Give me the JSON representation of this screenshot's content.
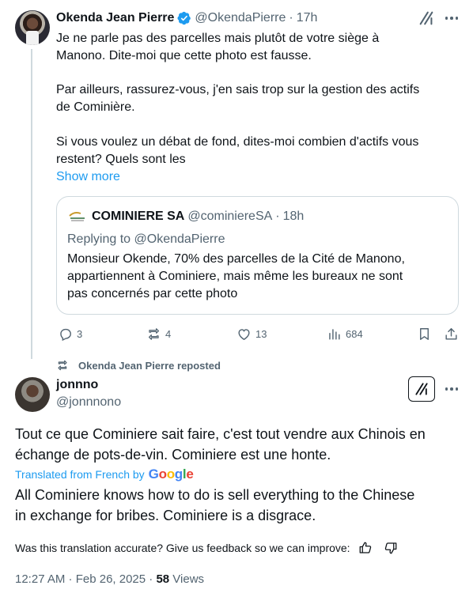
{
  "tweet1": {
    "author_name": "Okenda Jean Pierre",
    "author_handle": "@OkendaPierre",
    "time": "17h",
    "para1": "Je ne parle pas des parcelles mais plutôt de votre siège à\nManono. Dite-moi que cette photo est fausse.",
    "para2": "Par ailleurs, rassurez-vous, j'en sais trop sur la gestion des actifs\nde Cominière.",
    "para3": "Si vous voulez un débat de fond, dites-moi combien d'actifs vous\nrestent? Quels sont les",
    "show_more": "Show more",
    "quote": {
      "author_name": "COMINIERE SA",
      "author_handle": "@cominiereSA",
      "time": "18h",
      "replying_prefix": "Replying to",
      "replying_handle": "@OkendaPierre",
      "text": "Monsieur Okende, 70% des parcelles  de la Cité de Manono,\nappartiennent à  Cominiere,  mais même  les bureaux ne sont\npas concernés par cette photo"
    },
    "actions": {
      "replies": "3",
      "reposts": "4",
      "likes": "13",
      "views": "684"
    }
  },
  "repost_banner": "Okenda Jean Pierre reposted",
  "tweet2": {
    "author_name": "jonnno",
    "author_handle": "@jonnnono",
    "original_text": "Tout ce que Cominiere sait faire, c'est tout vendre aux Chinois en\néchange de pots-de-vin. Cominiere est une honte.",
    "translated_label": "Translated from French by",
    "translator": "Google",
    "translation": "All Cominiere knows how to do is sell everything to the Chinese\nin exchange for bribes. Cominiere is a disgrace.",
    "feedback_prompt": "Was this translation accurate? Give us feedback so we can improve:",
    "timestamp": "12:27 AM · Feb 26, 2025 · ",
    "views_count": "58",
    "views_label": " Views"
  },
  "colors": {
    "accent": "#1d9bf0",
    "secondary_text": "#536471",
    "border": "#cfd9de"
  },
  "icons": [
    "verified-badge-icon",
    "grok-icon",
    "more-icon",
    "reply-icon",
    "repost-icon",
    "like-icon",
    "views-icon",
    "bookmark-icon",
    "share-icon",
    "thumbs-up-icon",
    "thumbs-down-icon"
  ]
}
